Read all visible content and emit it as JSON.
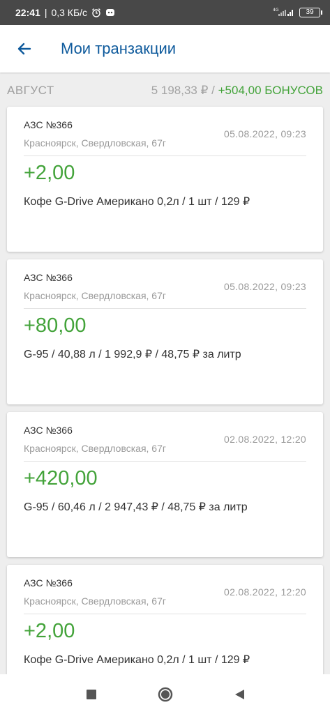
{
  "status_bar": {
    "time": "22:41",
    "speed": "0,3 КБ/с",
    "network": "4G",
    "battery": "39"
  },
  "header": {
    "title": "Мои транзакции"
  },
  "summary": {
    "month": "АВГУСТ",
    "total": "5 198,33 ₽ /",
    "bonus": "+504,00 БОНУСОВ"
  },
  "transactions": [
    {
      "station": "АЗС №366",
      "address": "Красноярск, Свердловская, 67г",
      "date": "05.08.2022, 09:23",
      "amount": "+2,00",
      "detail": "Кофе G-Drive Американо 0,2л / 1 шт / 129 ₽"
    },
    {
      "station": "АЗС №366",
      "address": "Красноярск, Свердловская, 67г",
      "date": "05.08.2022, 09:23",
      "amount": "+80,00",
      "detail": "G-95 / 40,88 л / 1 992,9 ₽ / 48,75 ₽ за литр"
    },
    {
      "station": "АЗС №366",
      "address": "Красноярск, Свердловская, 67г",
      "date": "02.08.2022, 12:20",
      "amount": "+420,00",
      "detail": "G-95 / 60,46 л / 2 947,43 ₽ / 48,75 ₽ за литр"
    },
    {
      "station": "АЗС №366",
      "address": "Красноярск, Свердловская, 67г",
      "date": "02.08.2022, 12:20",
      "amount": "+2,00",
      "detail": "Кофе G-Drive Американо 0,2л / 1 шт / 129 ₽"
    }
  ],
  "colors": {
    "accent": "#0e5a9c",
    "bonus_green": "#43a33a"
  }
}
